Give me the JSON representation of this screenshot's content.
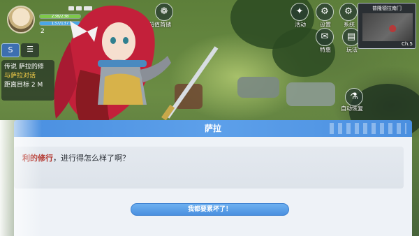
{
  "player": {
    "level": "2",
    "hp_text": "238/238",
    "mp_text": "137/137",
    "hp_fraction": 1.0,
    "mp_fraction": 1.0
  },
  "top_icons": [
    {
      "label": "超值首储",
      "icon": "gift-icon"
    }
  ],
  "menu": [
    {
      "label": "活动",
      "icon": "activity-icon",
      "glyph": "✦"
    },
    {
      "label": "设置",
      "icon": "gear-icon",
      "glyph": "⚙"
    },
    {
      "label": "系统",
      "icon": "system-icon",
      "glyph": "⚙"
    },
    {
      "label": "特惠",
      "icon": "shop-icon",
      "glyph": "✉"
    },
    {
      "label": "玩法",
      "icon": "gameplay-icon",
      "glyph": "▤"
    }
  ],
  "auto_recover": {
    "label": "自动恢复",
    "icon": "potion-icon"
  },
  "quest": {
    "tab_main": "S",
    "tab_other": "☰",
    "title": "传说 萨拉的修",
    "line2": "与萨拉对话",
    "line3": "距离目标 2 M"
  },
  "minimap": {
    "name": "普隆德拉南门",
    "channel": "Ch.5"
  },
  "dialog": {
    "speaker": "萨拉",
    "text_highlight": "利的修行",
    "text_rest": "，进行得怎么样了啊？",
    "choice": "我都要累坏了！"
  }
}
